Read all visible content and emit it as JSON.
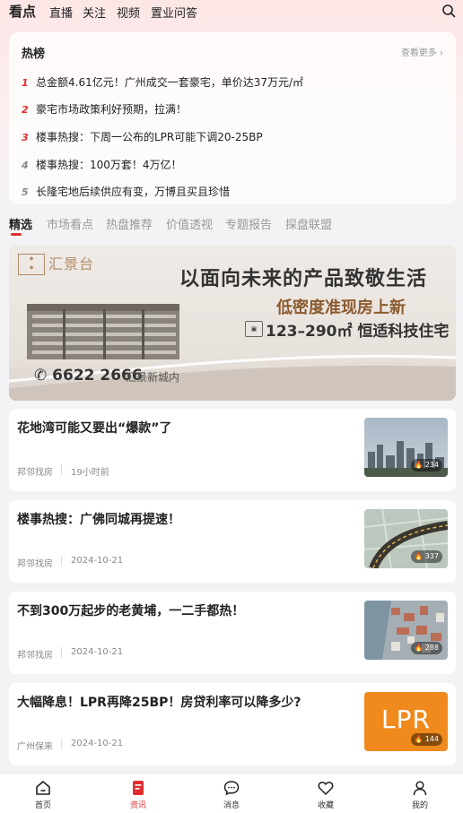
{
  "top_tabs": [
    "看点",
    "直播",
    "关注",
    "视频",
    "置业问答"
  ],
  "hot": {
    "title": "热榜",
    "more": "查看更多",
    "items": [
      {
        "rank": "1",
        "text": "总金额4.61亿元！广州成交一套豪宅，单价达37万元/㎡"
      },
      {
        "rank": "2",
        "text": "豪宅市场政策利好预期，拉满！"
      },
      {
        "rank": "3",
        "text": "楼事热搜：下周一公布的LPR可能下调20-25BP"
      },
      {
        "rank": "4",
        "text": "楼事热搜：100万套！4万亿！"
      },
      {
        "rank": "5",
        "text": "长隆宅地后续供应有变，万博且买且珍惜"
      }
    ]
  },
  "category_tabs": [
    "精选",
    "市场看点",
    "热盘推荐",
    "价值透视",
    "专题报告",
    "探盘联盟"
  ],
  "banner": {
    "logo_text": "汇景台",
    "headline": "以面向未来的产品致敬生活",
    "subline": "低密度准现房上新",
    "spec": "123–290㎡ 恒适科技住宅",
    "phone": "6622 2666",
    "phone_sub": "汇景新城内"
  },
  "news": [
    {
      "title": "花地湾可能又要出“爆款”了",
      "source": "邦邻找房",
      "time": "19小时前",
      "views": "234"
    },
    {
      "title": "楼事热搜：广佛同城再提速！",
      "source": "邦邻找房",
      "time": "2024-10-21",
      "views": "337"
    },
    {
      "title": "不到300万起步的老黄埔，一二手都热！",
      "source": "邦邻找房",
      "time": "2024-10-21",
      "views": "288"
    },
    {
      "title": "大幅降息！LPR再降25BP！房贷利率可以降多少?",
      "source": "广州保来",
      "time": "2024-10-21",
      "views": "144",
      "thumb_text": "LPR"
    }
  ],
  "bottom_nav": [
    {
      "label": "首页",
      "icon": "home-icon"
    },
    {
      "label": "资讯",
      "icon": "news-icon",
      "active": true
    },
    {
      "label": "消息",
      "icon": "message-icon"
    },
    {
      "label": "收藏",
      "icon": "heart-icon"
    },
    {
      "label": "我的",
      "icon": "user-icon"
    }
  ],
  "colors": {
    "accent": "#e02e2e",
    "lpr_bg": "#f08a1c"
  }
}
